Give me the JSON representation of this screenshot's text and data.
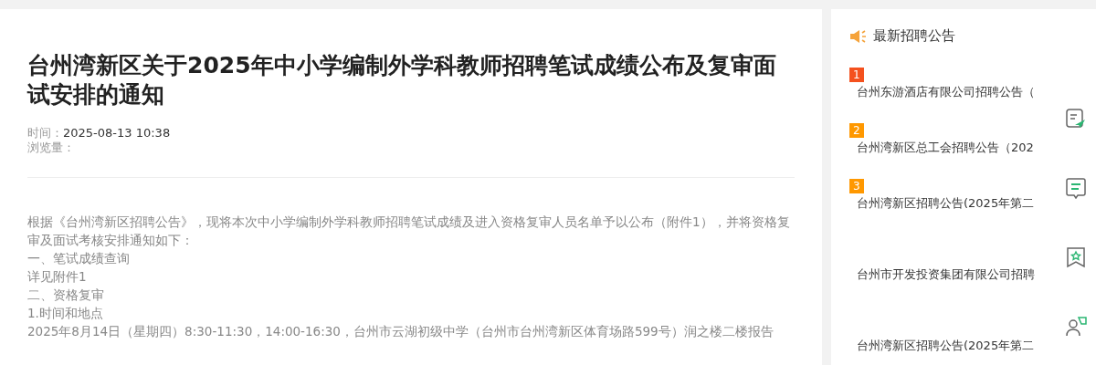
{
  "article": {
    "title": "台州湾新区关于2025年中小学编制外学科教师招聘笔试成绩公布及复审面试安排的通知",
    "meta": [
      {
        "label": "时间：",
        "value": "2025-08-13 10:38"
      },
      {
        "label": "浏览量："
      }
    ],
    "body": [
      "根据《台州湾新区招聘公告》，现将本次中小学编制外学科教师招聘笔试成绩及进入资格复审人员名单予以公布（附件1），并将资格复审及面试考核安排通知如下：",
      "一、笔试成绩查询",
      "详见附件1",
      "二、资格复审",
      "1.时间和地点",
      "2025年8月14日（星期四）8:30-11:30，14:00-16:30，台州市云湖初级中学（台州市台州湾新区体育场路599号）润之楼二楼报告"
    ]
  },
  "sidebar": {
    "title": "最新招聘公告",
    "items": [
      {
        "rank": "1",
        "color": "#f4511e",
        "title": "台州东游酒店有限公司招聘公告（"
      },
      {
        "rank": "2",
        "color": "#ff9800",
        "title": "台州湾新区总工会招聘公告（202"
      },
      {
        "rank": "3",
        "color": "#ff9800",
        "title": "台州湾新区招聘公告(2025年第二"
      },
      {
        "title": "台州市开发投资集团有限公司招聘"
      },
      {
        "title": "台州湾新区招聘公告(2025年第二"
      }
    ]
  }
}
